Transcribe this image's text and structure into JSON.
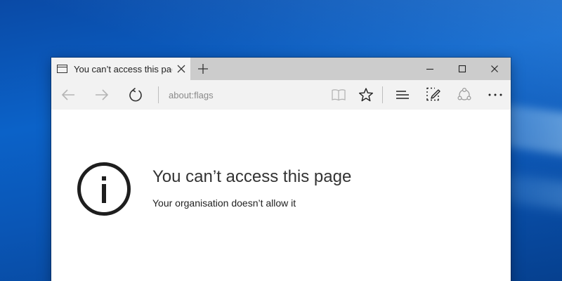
{
  "tab": {
    "title": "You can’t access this page"
  },
  "address_bar": {
    "value": "about:flags"
  },
  "page": {
    "title": "You can’t access this page",
    "message": "Your organisation doesn’t allow it"
  },
  "icons": {
    "tab_page": "page-icon",
    "tab_close": "close-icon",
    "new_tab": "plus-icon",
    "minimize": "minimize-icon",
    "maximize": "maximize-icon",
    "close": "close-icon",
    "back": "arrow-left-icon",
    "forward": "arrow-right-icon",
    "refresh": "refresh-icon",
    "reading_view": "book-icon",
    "favorite": "star-icon",
    "hub": "hub-lines-icon",
    "web_note": "pen-note-icon",
    "share": "share-icon",
    "more": "more-icon",
    "info": "info-icon"
  },
  "colors": {
    "titlebar": "#cccccc",
    "toolbar": "#f2f2f2",
    "desktop": "#0b62c8"
  }
}
